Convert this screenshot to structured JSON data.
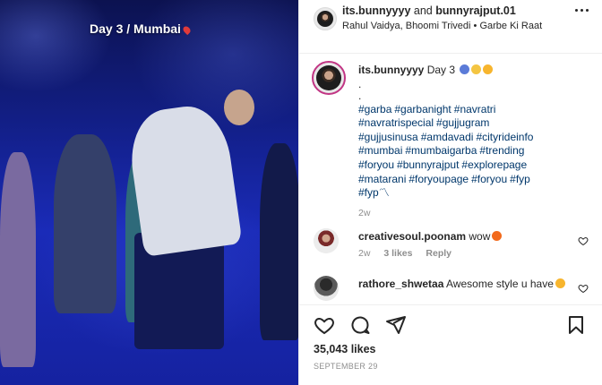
{
  "media": {
    "overlay_text": "Day 3 / Mumbai",
    "overlay_icon": "pin-icon"
  },
  "header": {
    "user1": "its.bunnyyyy",
    "connector": " and ",
    "user2": "bunnyrajput.01",
    "audio": "Rahul Vaidya, Bhoomi Trivedi • Garbe Ki Raat",
    "more_icon": "more-options-icon"
  },
  "post": {
    "username": "its.bunnyyyy",
    "text": "Day 3",
    "dots": [
      ".",
      "."
    ],
    "hashtags": [
      "#garba",
      "#garbanight",
      "#navratri",
      "#navratrispecial",
      "#gujjugram",
      "#gujjusinusa",
      "#amdavadi",
      "#cityrideinfo",
      "#mumbai",
      "#mumbaigarba",
      "#trending",
      "#foryou",
      "#bunnyrajput",
      "#explorepage",
      "#matarani",
      "#foryoupage",
      "#foryou",
      "#fyp",
      "#fyp"
    ],
    "tail": "〽",
    "time": "2w"
  },
  "comments": [
    {
      "username": "creativesoul.poonam",
      "text": "wow",
      "time": "2w",
      "likes": "3 likes",
      "reply": "Reply"
    },
    {
      "username": "rathore_shwetaa",
      "text": "Awesome style u have"
    }
  ],
  "actions": {
    "like_icon": "heart-icon",
    "comment_icon": "comment-icon",
    "share_icon": "share-icon",
    "save_icon": "bookmark-icon"
  },
  "likes": "35,043 likes",
  "date": "SEPTEMBER 29",
  "colors": {
    "link": "#00376b",
    "muted": "#8e8e8e",
    "text": "#262626",
    "ring": "#c13584"
  }
}
